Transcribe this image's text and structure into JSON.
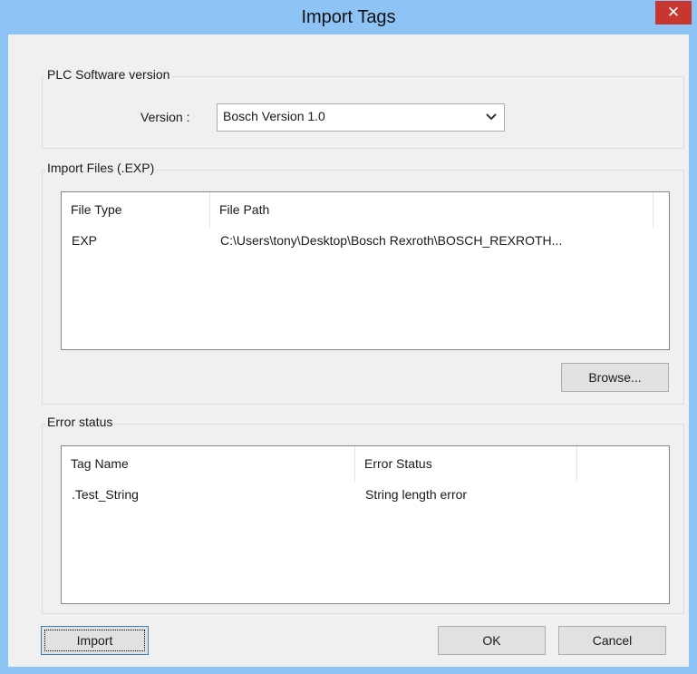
{
  "window": {
    "title": "Import Tags",
    "close_glyph": "✕",
    "titlebar_color": "#8ec4f5",
    "close_color": "#c7372f"
  },
  "plc_group": {
    "title": "PLC Software version",
    "version_label": "Version :",
    "version_selected": "Bosch Version 1.0"
  },
  "import_group": {
    "title": "Import Files (.EXP)",
    "columns": [
      "File Type",
      "File Path"
    ],
    "rows": [
      [
        "EXP",
        "C:\\Users\\tony\\Desktop\\Bosch Rexroth\\BOSCH_REXROTH..."
      ]
    ],
    "browse_label": "Browse..."
  },
  "error_group": {
    "title": "Error status",
    "columns": [
      "Tag Name",
      "Error Status"
    ],
    "rows": [
      [
        ".Test_String",
        "String length error"
      ]
    ]
  },
  "footer": {
    "import_label": "Import",
    "ok_label": "OK",
    "cancel_label": "Cancel"
  }
}
